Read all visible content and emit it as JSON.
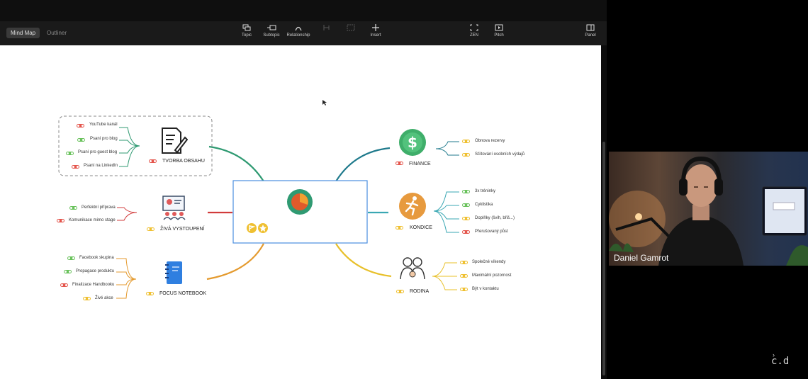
{
  "tabs": [
    {
      "label": "Mind Map",
      "active": true
    },
    {
      "label": "Outliner",
      "active": false
    }
  ],
  "toolbar": {
    "topic": "Topic",
    "subtopic": "Subtopic",
    "relationship": "Relationship",
    "zen": "ZEN",
    "pitch": "Pitch",
    "insert": "Insert",
    "panel": "Panel"
  },
  "mindmap": {
    "branches": [
      {
        "title": "TVORBA OBSAHU",
        "color": "#2f9a72",
        "icon": "document-pen-icon",
        "children": [
          "YouTube kanál",
          "Psaní pro blog",
          "Psaní pro guest blog",
          "Psaní na LinkedIn"
        ]
      },
      {
        "title": "ŽIVÁ VYSTOUPENÍ",
        "color": "#d13b3b",
        "icon": "presentation-board-icon",
        "children": [
          "Perfektní příprava",
          "Komunikace mimo stage"
        ]
      },
      {
        "title": "FOCUS NOTEBOOK",
        "color": "#e49a2e",
        "icon": "notebook-icon",
        "children": [
          "Facebook skupina",
          "Propagace produktu",
          "Finalizace Handbooku",
          "Živé akce"
        ]
      },
      {
        "title": "FINANCE",
        "color": "#1f7a8c",
        "icon": "dollar-icon",
        "children": [
          "Obnova rezervy",
          "Sčítování osobních výdajů"
        ]
      },
      {
        "title": "KONDICE",
        "color": "#3aa7b3",
        "icon": "running-icon",
        "children": [
          "3x tréninky",
          "Cyklistika",
          "Doplňky (švih, břiš...)",
          "Přerušovaný půst"
        ]
      },
      {
        "title": "RODINA",
        "color": "#e8c02a",
        "icon": "family-icon",
        "children": [
          "Společné víkendy",
          "Maximální pozornost",
          "Být v kontaktu"
        ]
      }
    ]
  },
  "webcam": {
    "name": "Daniel Gamrot"
  },
  "logo": {
    "text": "c.d"
  }
}
